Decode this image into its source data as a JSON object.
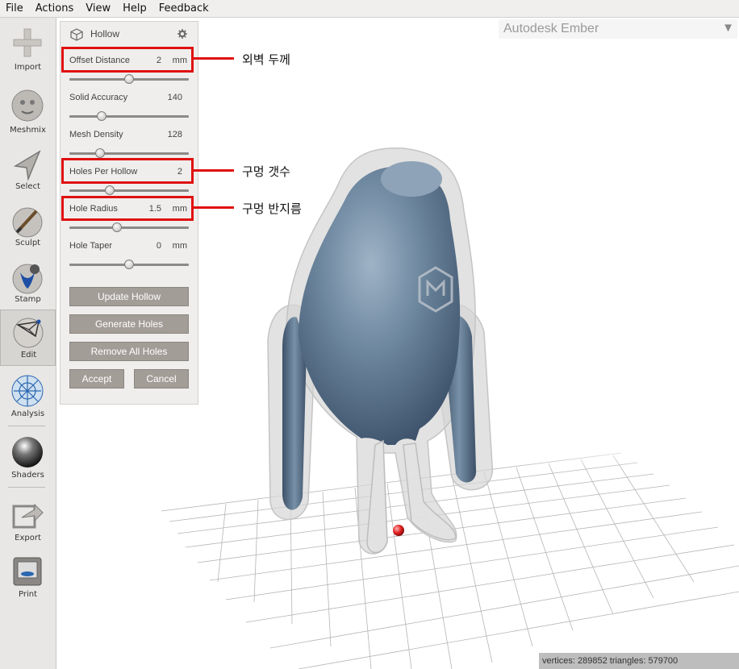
{
  "menu": {
    "items": [
      {
        "label": "File"
      },
      {
        "label": "Actions"
      },
      {
        "label": "View"
      },
      {
        "label": "Help"
      },
      {
        "label": "Feedback"
      }
    ]
  },
  "toolbar": {
    "import_label": "Import",
    "meshmix_label": "Meshmix",
    "select_label": "Select",
    "sculpt_label": "Sculpt",
    "stamp_label": "Stamp",
    "edit_label": "Edit",
    "analysis_label": "Analysis",
    "shaders_label": "Shaders",
    "export_label": "Export",
    "print_label": "Print",
    "active_tool": "Edit"
  },
  "panel": {
    "title": "Hollow",
    "offset_distance": {
      "label": "Offset Distance",
      "value": "2",
      "unit": "mm",
      "slider_fraction": 0.5
    },
    "solid_accuracy": {
      "label": "Solid Accuracy",
      "value": "140",
      "slider_fraction": 0.27
    },
    "mesh_density": {
      "label": "Mesh Density",
      "value": "128",
      "slider_fraction": 0.26
    },
    "holes_per_hollow": {
      "label": "Holes Per Hollow",
      "value": "2",
      "slider_fraction": 0.34
    },
    "hole_radius": {
      "label": "Hole Radius",
      "value": "1.5",
      "unit": "mm",
      "slider_fraction": 0.4
    },
    "hole_taper": {
      "label": "Hole Taper",
      "value": "0",
      "unit": "mm",
      "slider_fraction": 0.5
    },
    "update_hollow_label": "Update Hollow",
    "generate_holes_label": "Generate Holes",
    "remove_all_holes_label": "Remove All Holes",
    "accept_label": "Accept",
    "cancel_label": "Cancel"
  },
  "annotations": {
    "wall_thickness": "외벽 두께",
    "hole_count": "구멍 갯수",
    "hole_radius": "구멍 반지름"
  },
  "ember": {
    "title": "Autodesk Ember"
  },
  "status": {
    "text": "vertices: 289852 triangles: 579700"
  },
  "colors": {
    "highlight": "#e01010",
    "button": "#a39d98",
    "model_inner": "#5e7a94",
    "model_shell": "#d9d9d9",
    "marker": "#e02020"
  },
  "icons": {
    "import": "plus-icon",
    "meshmix": "head-sphere-icon",
    "select": "arrow-cursor-icon",
    "sculpt": "brush-sphere-icon",
    "stamp": "fleur-sphere-icon",
    "edit": "grid-sphere-icon",
    "analysis": "mesh-sphere-icon",
    "shaders": "chrome-sphere-icon",
    "export": "export-arrow-icon",
    "print": "printer-icon",
    "panel": "cube-icon",
    "settings": "gear-icon",
    "dropdown": "triangle-down-icon"
  }
}
